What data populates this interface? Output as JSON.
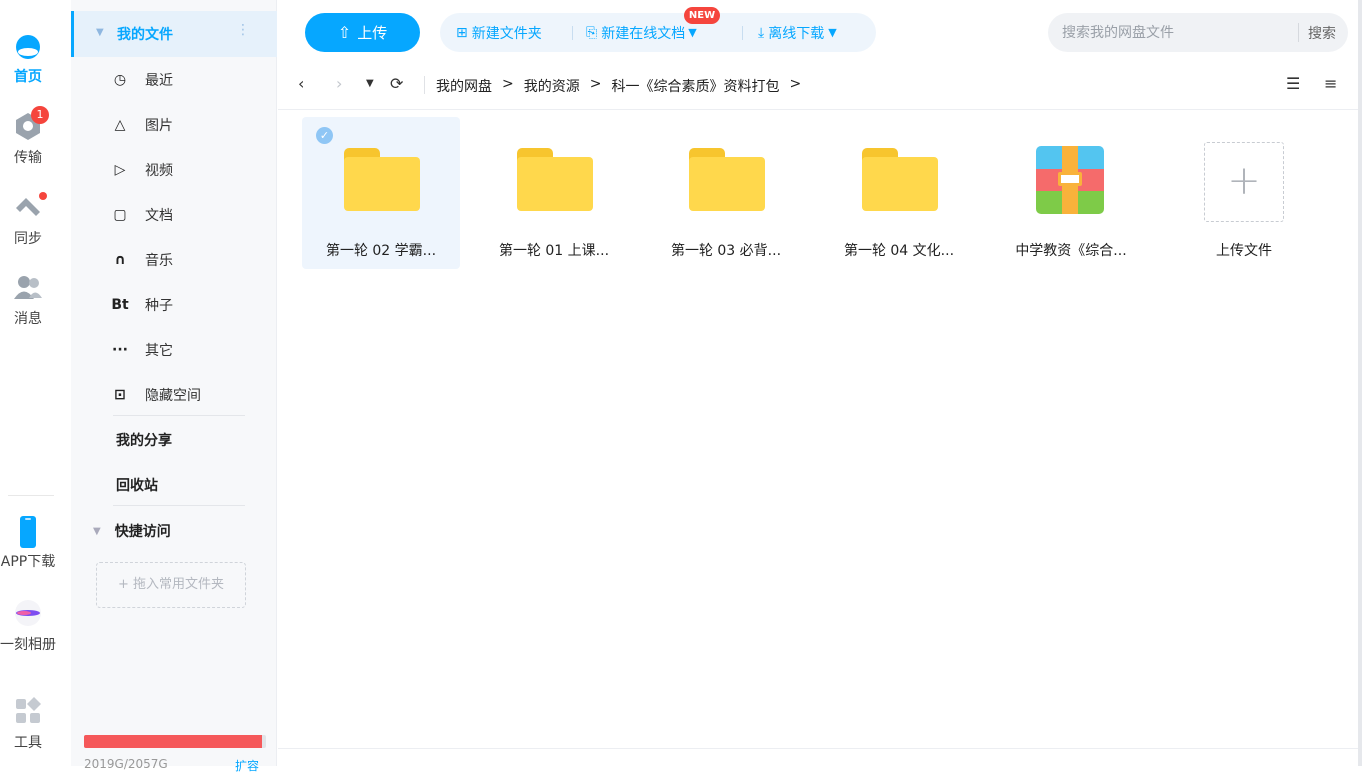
{
  "rail": {
    "home": "首页",
    "transfer": "传输",
    "transfer_badge": "1",
    "sync": "同步",
    "messages": "消息",
    "app_download": "APP下载",
    "album": "一刻相册",
    "tools": "工具"
  },
  "sidebar": {
    "my_files": "我的文件",
    "more_glyph": "⋮",
    "categories": [
      {
        "icon": "clock-icon",
        "label": "最近"
      },
      {
        "icon": "image-icon",
        "label": "图片"
      },
      {
        "icon": "play-icon",
        "label": "视频"
      },
      {
        "icon": "document-icon",
        "label": "文档"
      },
      {
        "icon": "headphones-icon",
        "label": "音乐"
      },
      {
        "icon": "bt-icon",
        "label": "种子",
        "glyph": "Bt"
      },
      {
        "icon": "ellipsis-icon",
        "label": "其它"
      },
      {
        "icon": "lock-icon",
        "label": "隐藏空间"
      }
    ],
    "my_share": "我的分享",
    "recycle_bin": "回收站",
    "quick_access": "快捷访问",
    "drop_hint": "+ 拖入常用文件夹",
    "quota_text": "2019G/2057G",
    "quota_fraction": 0.98,
    "expand": "扩容"
  },
  "toolbar": {
    "upload": "上传",
    "new_folder": "新建文件夹",
    "new_online_doc": "新建在线文档",
    "new_badge": "NEW",
    "offline_download": "离线下载",
    "search_placeholder": "搜索我的网盘文件",
    "search_button": "搜索"
  },
  "breadcrumb": [
    "我的网盘",
    "我的资源",
    "科一《综合素质》资料打包"
  ],
  "files": [
    {
      "name": "第一轮 02 学霸...",
      "type": "folder",
      "selected": true
    },
    {
      "name": "第一轮 01 上课...",
      "type": "folder",
      "selected": false
    },
    {
      "name": "第一轮 03 必背...",
      "type": "folder",
      "selected": false
    },
    {
      "name": "第一轮 04 文化...",
      "type": "folder",
      "selected": false
    },
    {
      "name": "中学教资《综合...",
      "type": "archive",
      "selected": false
    }
  ],
  "upload_tile": "上传文件",
  "colors": {
    "accent": "#06a7ff",
    "folder": "#ffd84c",
    "alert": "#f5453d"
  }
}
